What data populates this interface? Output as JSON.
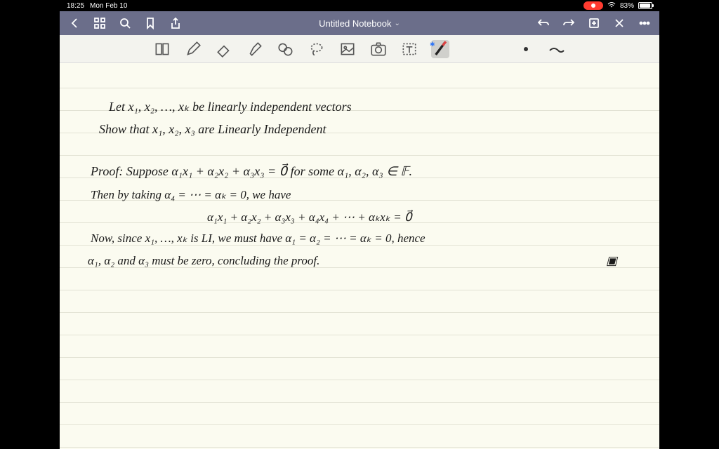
{
  "status": {
    "time": "18:25",
    "date": "Mon Feb 10",
    "battery_pct": "83%",
    "wifi": "wifi-icon"
  },
  "header": {
    "title": "Untitled Notebook",
    "dropdown_indicator": "›"
  },
  "tools": {
    "page_nav": "page-nav-icon",
    "pen": "pen-icon",
    "eraser": "eraser-icon",
    "highlighter": "highlighter-icon",
    "shapes": "shapes-icon",
    "lasso": "lasso-icon",
    "image": "image-icon",
    "camera": "camera-icon",
    "text": "text-icon",
    "stylus": "stylus-icon"
  },
  "notes": {
    "line1": "Let  x₁, x₂, …, xₖ  be  linearly  independent  vectors",
    "line2": "Show that  x₁, x₂, x₃  are  Linearly  Independent",
    "line3": "Proof:  Suppose  α₁x₁ + α₂x₂ + α₃x₃ = 0⃗  for some  α₁, α₂, α₃ ∈ 𝔽.",
    "line4": "Then by taking  α₄ = ⋯ = αₖ = 0, we have",
    "line5": "α₁x₁ + α₂x₂ + α₃x₃ + α₄x₄ + ⋯ + αₖxₖ  =  0⃗",
    "line6": "Now, since  x₁, …, xₖ  is  LI,  we  must  have   α₁ = α₂ = ⋯ = αₖ = 0,   hence",
    "line7": "α₁, α₂ and α₃  must  be  zero,  concluding  the  proof.",
    "qed": "▣"
  }
}
